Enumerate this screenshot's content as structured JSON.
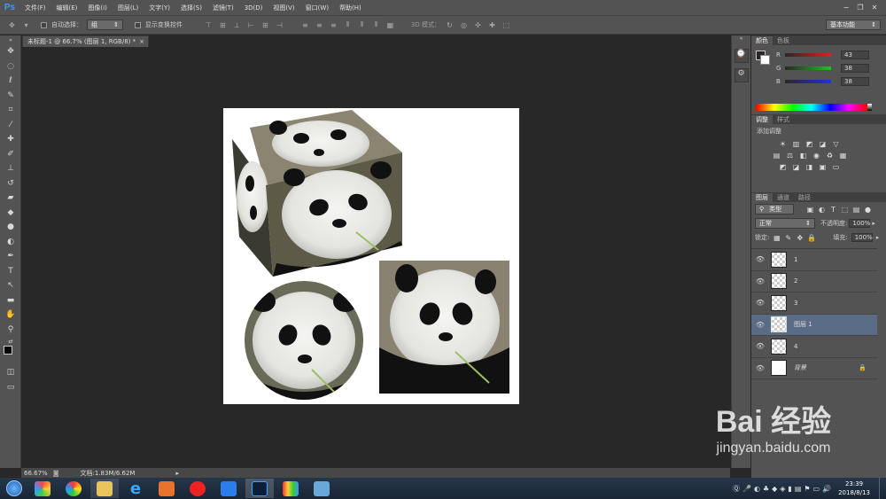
{
  "menubar": {
    "logo": "Ps",
    "items": [
      "文件(F)",
      "编辑(E)",
      "图像(I)",
      "图层(L)",
      "文字(Y)",
      "选择(S)",
      "滤镜(T)",
      "3D(D)",
      "视图(V)",
      "窗口(W)",
      "帮助(H)"
    ],
    "win_buttons": [
      "−",
      "❐",
      "✕"
    ]
  },
  "options": {
    "auto_select_label": "自动选择：",
    "auto_select_value": "组",
    "show_transform_label": "显示变换控件",
    "mode_3d_label": "3D 模式：",
    "workspace": "基本功能"
  },
  "document": {
    "tab_title": "未标题-1 @ 66.7% (图层 1, RGB/8) *",
    "tab_close": "×"
  },
  "status": {
    "zoom": "66.67%",
    "doc_info": "文档:1.83M/6.62M"
  },
  "color_panel": {
    "tabs": [
      "颜色",
      "色板"
    ],
    "channels": [
      {
        "label": "R",
        "value": "43",
        "color": "#e02020"
      },
      {
        "label": "G",
        "value": "38",
        "color": "#20c020"
      },
      {
        "label": "B",
        "value": "38",
        "color": "#2030e0"
      }
    ],
    "foreground": "#2b2626",
    "background": "#ffffff"
  },
  "adjust_panel": {
    "tabs": [
      "调整",
      "样式"
    ],
    "title": "添加调整"
  },
  "layers_panel": {
    "tabs": [
      "图层",
      "通道",
      "路径"
    ],
    "filter_label": "类型",
    "blend_mode": "正常",
    "opacity_label": "不透明度:",
    "opacity_value": "100%",
    "lock_label": "锁定:",
    "fill_label": "填充:",
    "fill_value": "100%",
    "layers": [
      {
        "name": "1",
        "selected": false
      },
      {
        "name": "2",
        "selected": false
      },
      {
        "name": "3",
        "selected": false
      },
      {
        "name": "图层 1",
        "selected": true
      },
      {
        "name": "4",
        "selected": false
      },
      {
        "name": "背景",
        "selected": false,
        "italic": true,
        "locked": true
      }
    ]
  },
  "taskbar": {
    "time": "23:39",
    "date": "2018/8/13"
  },
  "watermark": {
    "logo": "Bai 经验",
    "url": "jingyan.baidu.com"
  }
}
